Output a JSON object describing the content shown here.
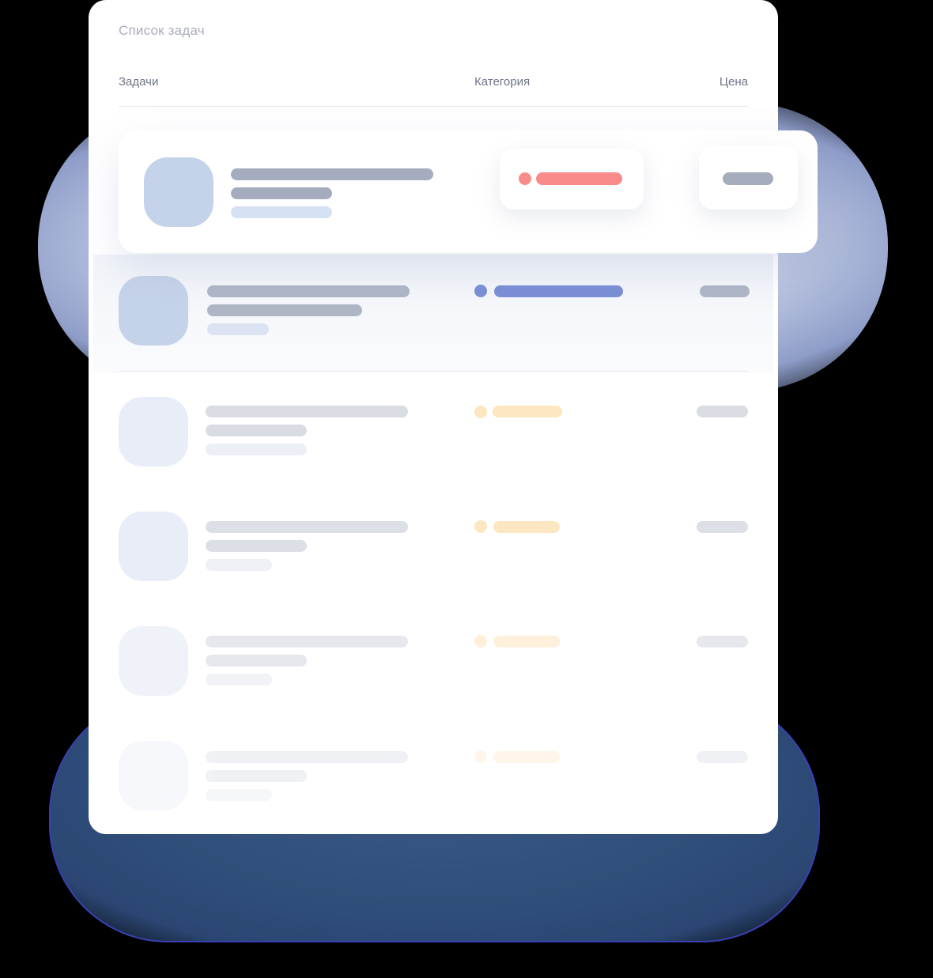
{
  "card": {
    "title": "Список задач",
    "columns": {
      "tasks": "Задачи",
      "category": "Категория",
      "price": "Цена"
    }
  },
  "colors": {
    "red_tag": "#f98b8b",
    "blue_tag": "#7b8fd6",
    "orange_tag": "#fde7c2",
    "avatar_blue": "#c5d3ea",
    "avatar_pale": "#e8edf7",
    "skeleton_dark": "#a4acbd",
    "skeleton_light": "#d9dce3"
  },
  "rows": [
    {
      "state": "highlighted",
      "category_color": "red"
    },
    {
      "state": "hover",
      "category_color": "blue"
    },
    {
      "state": "placeholder",
      "category_color": "orange"
    },
    {
      "state": "placeholder",
      "category_color": "orange"
    },
    {
      "state": "placeholder",
      "category_color": "orange"
    },
    {
      "state": "placeholder",
      "category_color": "orange"
    }
  ]
}
